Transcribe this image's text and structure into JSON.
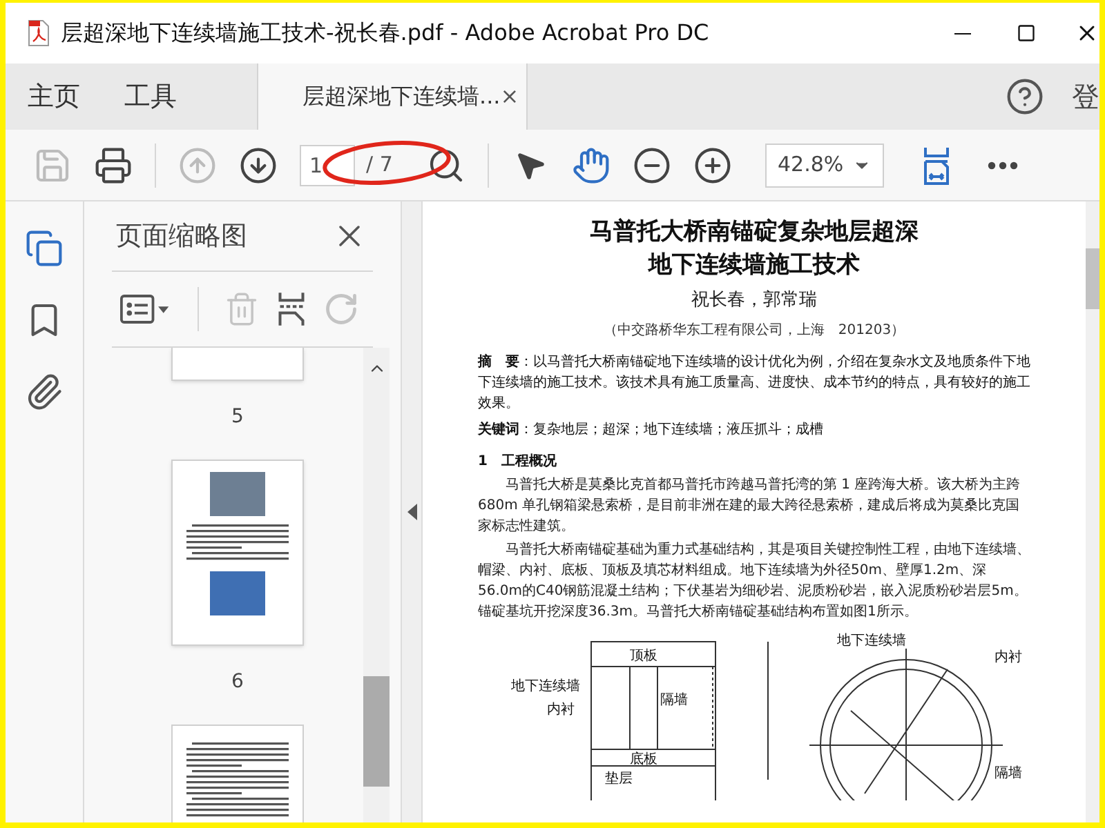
{
  "window": {
    "title": "层超深地下连续墙施工技术-祝长春.pdf - Adobe Acrobat Pro DC"
  },
  "nav_tabs": [
    {
      "label": "主页",
      "selected": false
    },
    {
      "label": "工具",
      "selected": false
    }
  ],
  "doc_tab": {
    "label": "层超深地下连续墙...",
    "selected": true,
    "close": "×"
  },
  "account": {
    "label": "登"
  },
  "toolbar": {
    "tools_left": [
      {
        "kind": "save",
        "disabled": true
      },
      {
        "kind": "print",
        "disabled": false
      },
      {
        "kind": "sep"
      },
      {
        "kind": "up",
        "disabled": true
      },
      {
        "kind": "down",
        "disabled": false
      }
    ],
    "page_current": "1",
    "page_total": "/ 7",
    "tools_mid": [
      {
        "kind": "find",
        "disabled": false
      },
      {
        "kind": "sep"
      },
      {
        "kind": "select",
        "selected": false
      },
      {
        "kind": "hand",
        "selected": true
      },
      {
        "kind": "zoom_out",
        "disabled": false
      },
      {
        "kind": "zoom_in",
        "disabled": false
      }
    ],
    "zoom": "42.8%",
    "tools_right": [
      {
        "kind": "fit",
        "disabled": false
      },
      {
        "kind": "more",
        "disabled": false
      }
    ]
  },
  "sidebar": {
    "tools": [
      {
        "kind": "pages",
        "selected": true
      },
      {
        "kind": "bookmarks",
        "selected": false
      },
      {
        "kind": "attachments",
        "selected": false
      }
    ]
  },
  "thumbnails": {
    "title": "页面缩略图",
    "tools": [
      {
        "kind": "options",
        "disabled": false
      },
      {
        "kind": "delete",
        "disabled": true
      },
      {
        "kind": "insert",
        "disabled": false
      },
      {
        "kind": "rotate",
        "disabled": true
      }
    ],
    "pages": [
      {
        "kind": "cut",
        "label": "5"
      },
      {
        "kind": "photos",
        "label": "6"
      },
      {
        "kind": "text"
      }
    ]
  },
  "document": {
    "title_lines": [
      "马普托大桥南锚碇复杂地层超深",
      "地下连续墙施工技术"
    ],
    "authors": "祝长春，郭常瑞",
    "affiliation": "（中交路桥华东工程有限公司，上海　201203）",
    "abstract": "**摘　要**：以马普托大桥南锚碇地下连续墙的设计优化为例，介绍在复杂水文及地质条件下地下连续墙的施工技术。该技术具有施工质量高、进度快、成本节约的特点，具有较好的施工效果。",
    "keywords": "**关键词**：复杂地层；超深；地下连续墙；液压抓斗；成槽",
    "heading": "1　工程概况",
    "paragraphs": [
      "马普托大桥是莫桑比克首都马普托市跨越马普托湾的第 1 座跨海大桥。该大桥为主跨 680m 单孔钢箱梁悬索桥，是目前非洲在建的最大跨径悬索桥，建成后将成为莫桑比克国家标志性建筑。",
      "马普托大桥南锚碇基础为重力式基础结构，其是项目关键控制性工程，由地下连续墙、帽梁、内衬、底板、顶板及填芯材料组成。地下连续墙为外径50m、壁厚1.2m、深56.0m的C40钢筋混凝土结构；下伏基岩为细砂岩、泥质粉砂岩，嵌入泥质粉砂岩层5m。锚碇基坑开挖深度36.3m。马普托大桥南锚碇基础结构布置如图1所示。"
    ],
    "figure_left_labels": [
      "顶板",
      "隔墙",
      "地下连续墙",
      "内衬",
      "底板",
      "垫层"
    ],
    "figure_right_labels": [
      "地下连续墙",
      "内衬",
      "隔墙"
    ]
  }
}
